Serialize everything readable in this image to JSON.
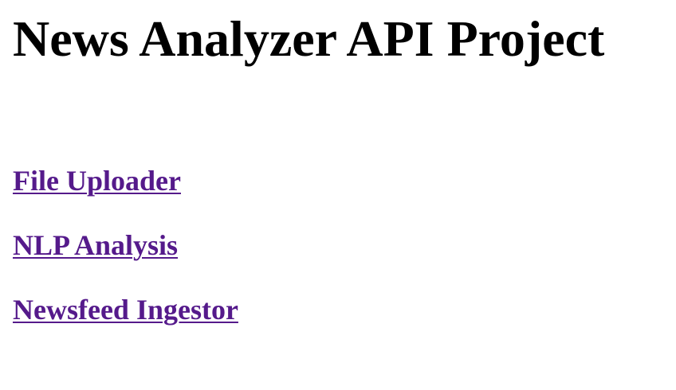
{
  "page": {
    "title": "News Analyzer API Project"
  },
  "links": [
    {
      "label": "File Uploader"
    },
    {
      "label": "NLP Analysis"
    },
    {
      "label": "Newsfeed Ingestor"
    }
  ],
  "colors": {
    "text": "#000000",
    "visited_link": "#551a8b",
    "background": "#ffffff"
  }
}
